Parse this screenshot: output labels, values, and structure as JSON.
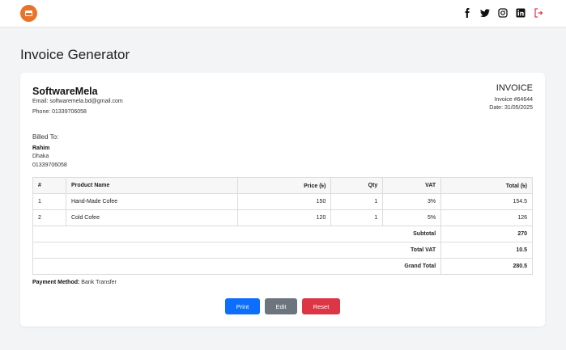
{
  "header": {
    "social_icons": [
      "facebook-icon",
      "twitter-icon",
      "instagram-icon",
      "linkedin-icon",
      "logout-icon"
    ],
    "logo_color": "#e8742a"
  },
  "page_title": "Invoice Generator",
  "company": {
    "name": "SoftwareMela",
    "email": "Email: softwaremela.bd@gmail.com",
    "phone": "Phone: 01339706058"
  },
  "invoice": {
    "title": "INVOICE",
    "number": "Invoice #64644",
    "date": "Date: 31/05/2025"
  },
  "billed_to": {
    "label": "Billed To:",
    "name": "Rahim",
    "city": "Dhaka",
    "phone": "01339706058"
  },
  "table": {
    "headers": {
      "num": "#",
      "product": "Product Name",
      "price": "Price (৳)",
      "qty": "Qty",
      "vat": "VAT",
      "total": "Total (৳)"
    },
    "rows": [
      {
        "num": "1",
        "product": "Hand-Made Cofee",
        "price": "150",
        "qty": "1",
        "vat": "3%",
        "total": "154.5"
      },
      {
        "num": "2",
        "product": "Cold Cofee",
        "price": "120",
        "qty": "1",
        "vat": "5%",
        "total": "126"
      }
    ],
    "summary": [
      {
        "label": "Subtotal",
        "value": "270"
      },
      {
        "label": "Total VAT",
        "value": "10.5"
      },
      {
        "label": "Grand Total",
        "value": "280.5"
      }
    ]
  },
  "payment": {
    "label": "Payment Method:",
    "value": "Bank Transfer"
  },
  "buttons": {
    "print": "Print",
    "edit": "Edit",
    "reset": "Reset"
  },
  "colors": {
    "primary": "#0d6efd",
    "secondary": "#6c757d",
    "danger": "#dc3545",
    "logout": "#dc3545"
  }
}
